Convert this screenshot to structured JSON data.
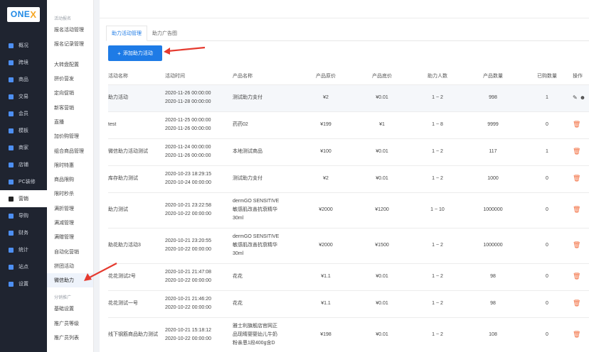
{
  "logo": {
    "text": "ONE",
    "mark": "X"
  },
  "nav": [
    {
      "label": "概况",
      "icon": "dashboard-icon"
    },
    {
      "label": "跨境",
      "icon": "globe-icon"
    },
    {
      "label": "商品",
      "icon": "product-icon"
    },
    {
      "label": "交易",
      "icon": "order-icon"
    },
    {
      "label": "会员",
      "icon": "member-icon"
    },
    {
      "label": "模板",
      "icon": "template-icon"
    },
    {
      "label": "商家",
      "icon": "store-icon"
    },
    {
      "label": "店铺",
      "icon": "shop-icon"
    },
    {
      "label": "PC装修",
      "icon": "pc-icon"
    },
    {
      "label": "营销",
      "icon": "gift-icon",
      "active": true
    },
    {
      "label": "导购",
      "icon": "guide-icon"
    },
    {
      "label": "财务",
      "icon": "finance-icon"
    },
    {
      "label": "统计",
      "icon": "stats-icon"
    },
    {
      "label": "站点",
      "icon": "site-icon"
    },
    {
      "label": "设置",
      "icon": "settings-icon"
    }
  ],
  "submenu": {
    "group1": "活动报名",
    "items1": [
      "报名活动管理",
      "报名记录管理"
    ],
    "items2": [
      "大转盘配置",
      "拼价营发",
      "定向促销",
      "新客营销",
      "直播",
      "加价购管理",
      "组合商品管理",
      "限时特惠",
      "商品限购",
      "限时秒杀",
      "满折管理",
      "满减管理",
      "满赠管理",
      "自动化营销",
      "拼团活动",
      "微信助力"
    ],
    "group2": "分销推广",
    "items3": [
      "基础设置",
      "推广员等级",
      "推广员列表"
    ]
  },
  "tabs": [
    "助力活动管理",
    "助力广告图"
  ],
  "add_button": "添加助力活动",
  "columns": [
    "活动名称",
    "活动时间",
    "产品名称",
    "产品原价",
    "产品底价",
    "助力人数",
    "产品数量",
    "已购数量",
    "操作"
  ],
  "rows": [
    {
      "name": "助力活动",
      "time1": "2020-11-26 00:00:00",
      "time2": "2020-11-28 00:00:00",
      "product": [
        "测试助力支付"
      ],
      "orig": "¥2",
      "floor": "¥0.01",
      "people": "1 ~ 2",
      "qty": "998",
      "sold": "1",
      "ops": "edit"
    },
    {
      "name": "test",
      "time1": "2020-11-25 00:00:00",
      "time2": "2020-11-26 00:00:00",
      "product": [
        "药药02"
      ],
      "orig": "¥199",
      "floor": "¥1",
      "people": "1 ~ 8",
      "qty": "9999",
      "sold": "0",
      "ops": "delete"
    },
    {
      "name": "微信助力活动测试",
      "time1": "2020-11-24 00:00:00",
      "time2": "2020-11-26 00:00:00",
      "product": [
        "本地测试商品"
      ],
      "orig": "¥100",
      "floor": "¥0.01",
      "people": "1 ~ 2",
      "qty": "117",
      "sold": "1",
      "ops": "delete"
    },
    {
      "name": "库存助力测试",
      "time1": "2020-10-23 18:29:15",
      "time2": "2020-10-24 00:00:00",
      "product": [
        "测试助力支付"
      ],
      "orig": "¥2",
      "floor": "¥0.01",
      "people": "1 ~ 2",
      "qty": "1000",
      "sold": "0",
      "ops": "delete"
    },
    {
      "name": "助力测试",
      "time1": "2020-10-21 23:22:58",
      "time2": "2020-10-22 00:00:00",
      "product": [
        "dermGO SENSITIVE",
        "敏感肌改善抗衰精华",
        "30ml"
      ],
      "orig": "¥2000",
      "floor": "¥1200",
      "people": "1 ~ 10",
      "qty": "1000000",
      "sold": "0",
      "ops": "delete"
    },
    {
      "name": "助花助力活动3",
      "time1": "2020-10-21 23:20:55",
      "time2": "2020-10-22 00:00:00",
      "product": [
        "dermGO SENSITIVE",
        "敏感肌改善抗衰精华",
        "30ml"
      ],
      "orig": "¥2000",
      "floor": "¥1500",
      "people": "1 ~ 2",
      "qty": "1000000",
      "sold": "0",
      "ops": "delete"
    },
    {
      "name": "花花测试2号",
      "time1": "2020-10-21 21:47:08",
      "time2": "2020-10-22 00:00:00",
      "product": [
        "花花"
      ],
      "orig": "¥1.1",
      "floor": "¥0.01",
      "people": "1 ~ 2",
      "qty": "98",
      "sold": "0",
      "ops": "delete"
    },
    {
      "name": "花花测试一号",
      "time1": "2020-10-21 21:46:20",
      "time2": "2020-10-22 00:00:00",
      "product": [
        "花花"
      ],
      "orig": "¥1.1",
      "floor": "¥0.01",
      "people": "1 ~ 2",
      "qty": "98",
      "sold": "0",
      "ops": "delete"
    },
    {
      "name": "线下钢筋商品助力测试",
      "time1": "2020-10-21 15:18:12",
      "time2": "2020-10-22 00:00:00",
      "product": [
        "雅士利旗舰店官网正",
        "品现睛婴婴幼儿牛奶",
        "粉亲恩1段400g含D"
      ],
      "orig": "¥198",
      "floor": "¥0.01",
      "people": "1 ~ 2",
      "qty": "108",
      "sold": "0",
      "ops": "delete"
    }
  ],
  "colors": {
    "accent": "#1e7be6",
    "danger": "#f26b3c",
    "sidebar": "#1f2430",
    "arrow": "#e53a2f"
  }
}
